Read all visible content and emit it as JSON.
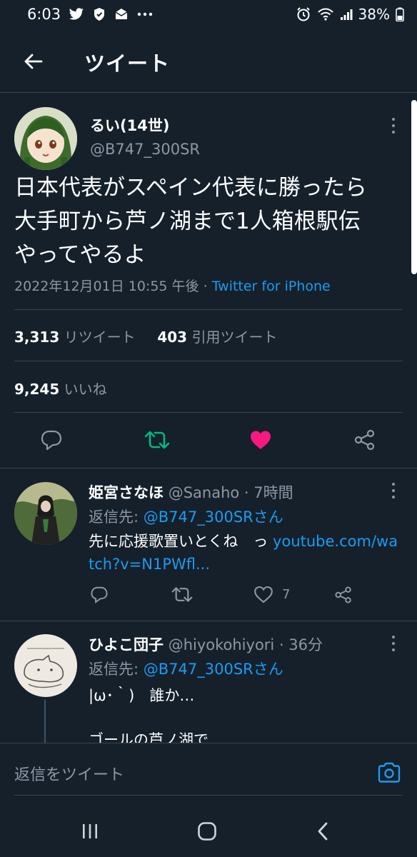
{
  "status_bar": {
    "time": "6:03",
    "battery": "38%",
    "left_icons": [
      "twitter-icon",
      "shield-icon",
      "mail-icon",
      "more-dots-icon"
    ],
    "right_icons": [
      "alarm-icon",
      "wifi-icon",
      "signal-icon",
      "battery-icon"
    ]
  },
  "header": {
    "title": "ツイート"
  },
  "tweet": {
    "name": "るい(14世)",
    "handle": "@B747_300SR",
    "text_lines": [
      "日本代表がスペイン代表に勝ったら",
      "大手町から芦ノ湖まで1人箱根駅伝",
      "やってやるよ"
    ],
    "timestamp": "2022年12月01日 10:55 午後",
    "separator": "·",
    "source": "Twitter for iPhone",
    "retweets": "3,313",
    "retweets_label": "リツイート",
    "quotes": "403",
    "quotes_label": "引用ツイート",
    "likes": "9,245",
    "likes_label": "いいね",
    "like_color": "#f91880",
    "retweet_color": "#00ba7c"
  },
  "replies": [
    {
      "name": "姫宮さなほ",
      "handle": "@Sanaho",
      "time": "· 7時間",
      "reply_to_label": "返信先: ",
      "reply_to": "@B747_300SRさん",
      "text": "先に応援歌置いとくね　っ ",
      "link": "youtube.com/watch?v=N1PWfl...",
      "likes": "7"
    },
    {
      "name": "ひよこ団子",
      "handle": "@hiyokohiyori",
      "time": "· 36分",
      "reply_to_label": "返信先: ",
      "reply_to": "@B747_300SRさん",
      "text_line1": "|ω･｀)　誰か…",
      "text_line2": "ゴールの芦ノ湖で"
    }
  ],
  "reply_bar": {
    "placeholder": "返信をツイート"
  },
  "colors": {
    "background": "#15202b",
    "accent": "#1d9bf0",
    "muted": "#8b98a5"
  }
}
